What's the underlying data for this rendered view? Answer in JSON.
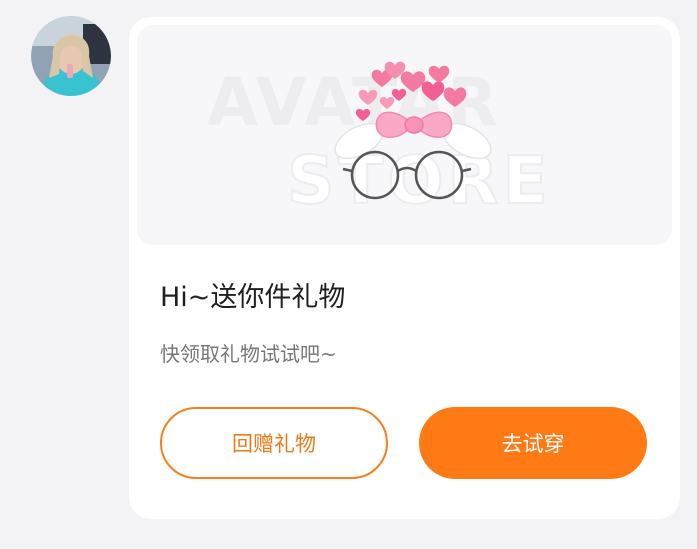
{
  "gift_card": {
    "banner_watermark_line1": "AVATAR",
    "banner_watermark_line2": "STORE",
    "title": "Hi~送你件礼物",
    "subtitle": "快领取礼物试试吧~",
    "return_gift_label": "回赠礼物",
    "try_on_label": "去试穿"
  },
  "colors": {
    "accent": "#ff7a14",
    "outline_accent": "#fa7f1c",
    "card_bg": "#ffffff",
    "page_bg": "#f3f3f5"
  },
  "icons": {
    "avatar": "user-avatar",
    "gift_item": "bow-glasses-accessory"
  }
}
